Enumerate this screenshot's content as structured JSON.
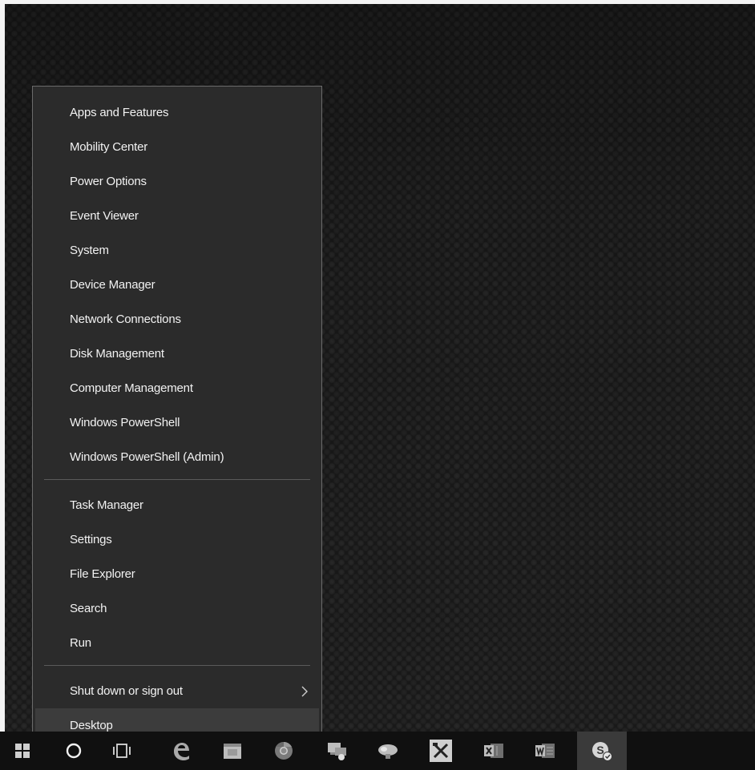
{
  "menu": {
    "items_group1": [
      "Apps and Features",
      "Mobility Center",
      "Power Options",
      "Event Viewer",
      "System",
      "Device Manager",
      "Network Connections",
      "Disk Management",
      "Computer Management",
      "Windows PowerShell",
      "Windows PowerShell (Admin)"
    ],
    "items_group2": [
      "Task Manager",
      "Settings",
      "File Explorer",
      "Search",
      "Run"
    ],
    "shutdown": "Shut down or sign out",
    "desktop": "Desktop"
  },
  "taskbar": {
    "icons": [
      "start-windows-icon",
      "cortana-circle-icon",
      "task-view-icon",
      "edge-icon",
      "store-icon",
      "chrome-icon",
      "remote-desktop-icon",
      "network-tool-icon",
      "tools-icon",
      "excel-icon",
      "word-icon",
      "skype-icon"
    ]
  },
  "colors": {
    "menu_bg": "#2b2b2b",
    "menu_text": "#f2f2f2",
    "taskbar_bg": "#101010",
    "selected_bg": "#3c3c3c"
  }
}
